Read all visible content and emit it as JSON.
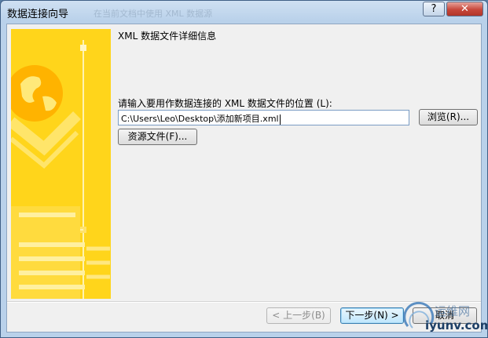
{
  "window": {
    "title": "数据连接向导",
    "ghost_title": "在当前文档中使用 XML 数据源",
    "help_label": "?",
    "close_label": "✕"
  },
  "wizard": {
    "heading": "XML 数据文件详细信息",
    "location_label": "请输入要用作数据连接的 XML 数据文件的位置 (L):",
    "path_value": "C:\\Users\\Leo\\Desktop\\添加新项目.xml"
  },
  "buttons": {
    "browse": "浏览(R)...",
    "resources": "资源文件(F)...",
    "back": "< 上一步(B)",
    "next": "下一步(N) >",
    "cancel": "取消"
  },
  "watermark": {
    "cn": "运维网",
    "en": "iyunv.com"
  },
  "colors": {
    "side_panel": "#ffd51b",
    "title_bar": "#b9d1ea",
    "close_button": "#c7473a"
  }
}
